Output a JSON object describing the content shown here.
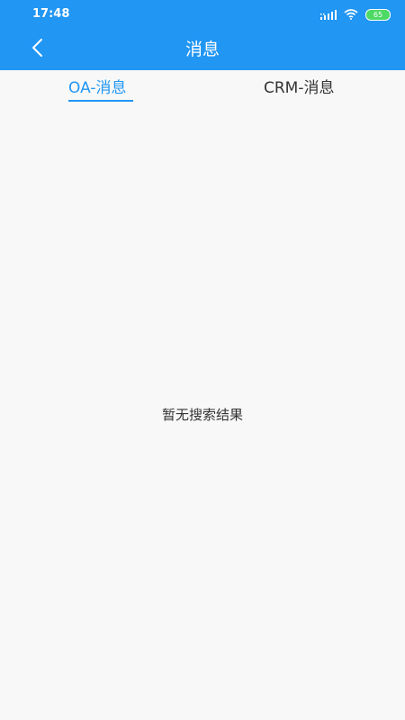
{
  "status_bar": {
    "time": "17:48",
    "battery_level": "65",
    "icons": [
      "signal-icon",
      "wifi-icon",
      "battery-icon"
    ]
  },
  "header": {
    "title": "消息",
    "back_icon": "chevron-left-icon"
  },
  "tabs": [
    {
      "label": "OA-消息",
      "active": true
    },
    {
      "label": "CRM-消息",
      "active": false
    }
  ],
  "content": {
    "empty_message": "暂无搜索结果"
  },
  "colors": {
    "primary": "#2196f3",
    "background": "#f8f8f8",
    "text": "#333333",
    "battery": "#4cd964"
  }
}
